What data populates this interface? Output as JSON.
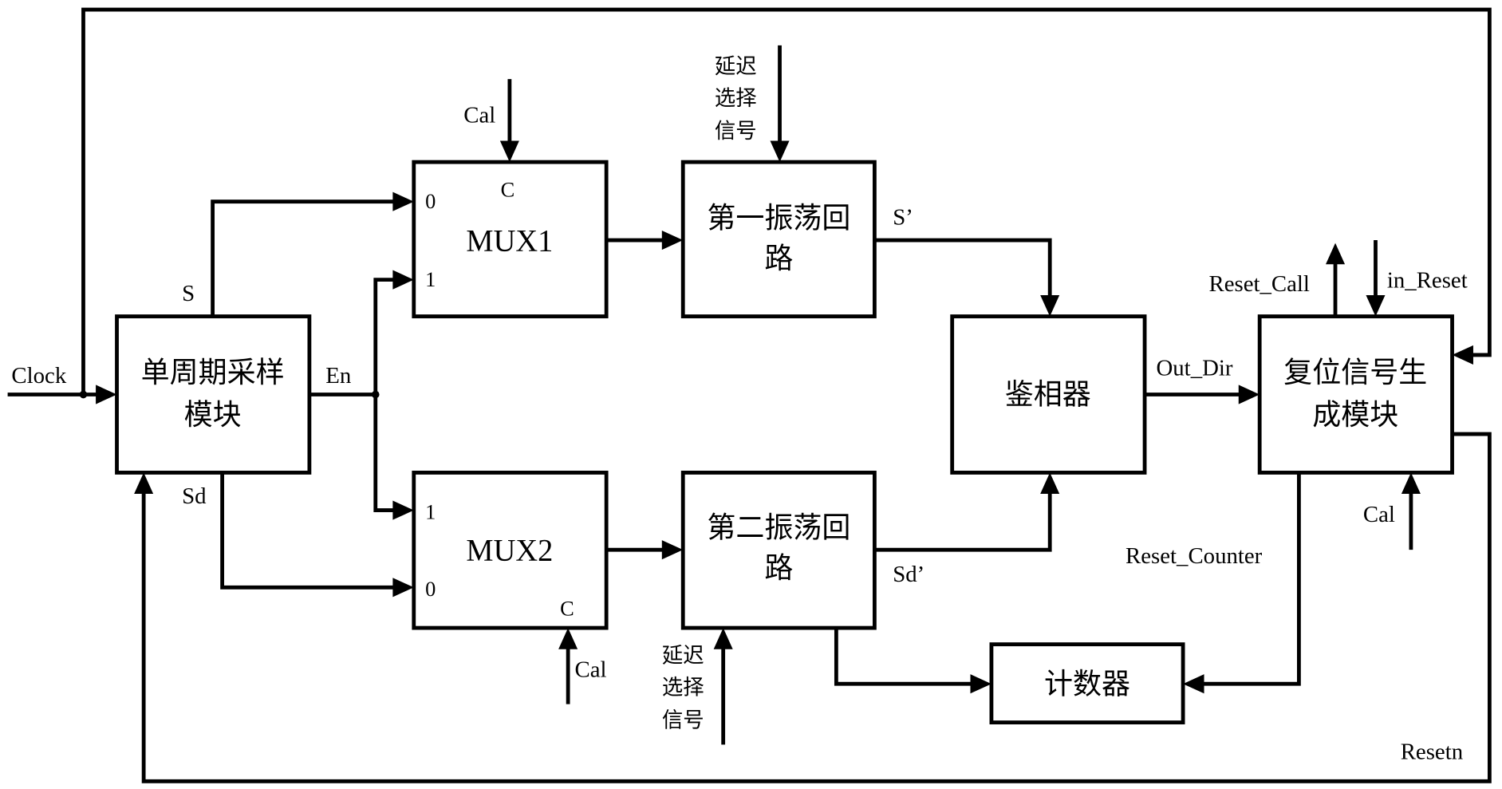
{
  "diagram": {
    "blocks": {
      "sampler": {
        "line1": "单周期采样",
        "line2": "模块"
      },
      "mux1": {
        "label": "MUX1",
        "port_0": "0",
        "port_1": "1",
        "port_c": "C"
      },
      "mux2": {
        "label": "MUX2",
        "port_0": "0",
        "port_1": "1",
        "port_c": "C"
      },
      "osc1": {
        "line1": "第一振荡回",
        "line2": "路"
      },
      "osc2": {
        "line1": "第二振荡回",
        "line2": "路"
      },
      "phase_detector": {
        "label": "鉴相器"
      },
      "reset_gen": {
        "line1": "复位信号生",
        "line2": "成模块"
      },
      "counter": {
        "label": "计数器"
      }
    },
    "signals": {
      "clock": "Clock",
      "s": "S",
      "sd": "Sd",
      "en": "En",
      "cal_mux1": "Cal",
      "cal_mux2": "Cal",
      "cal_reset": "Cal",
      "delay_select_top": [
        "延迟",
        "选择",
        "信号"
      ],
      "delay_select_bottom": [
        "延迟",
        "选择",
        "信号"
      ],
      "s_prime": "S’",
      "sd_prime": "Sd’",
      "out_dir": "Out_Dir",
      "reset_call": "Reset_Call",
      "in_reset": "in_Reset",
      "reset_counter": "Reset_Counter",
      "resetn": "Resetn"
    }
  }
}
